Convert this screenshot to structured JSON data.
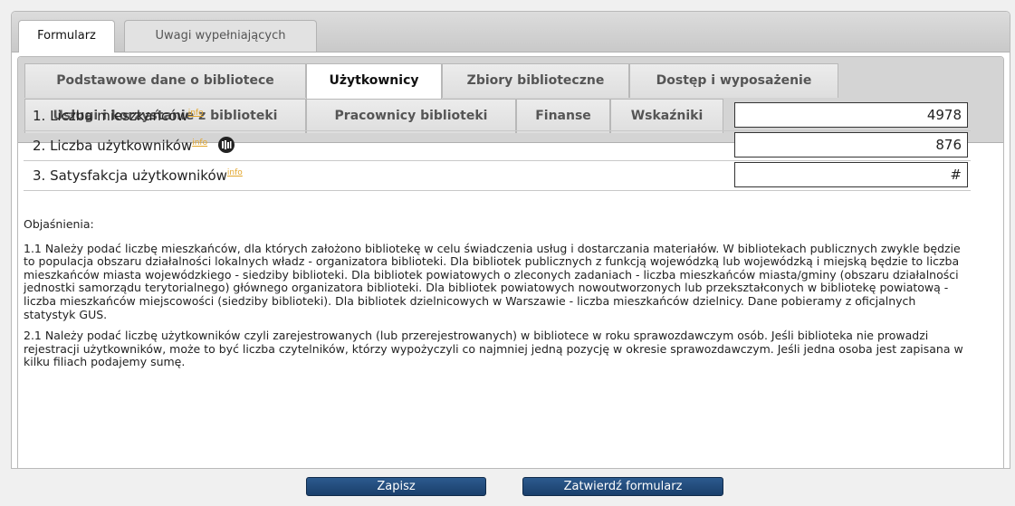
{
  "outer_tabs": [
    {
      "label": "Formularz",
      "active": true
    },
    {
      "label": "Uwagi wypełniających",
      "active": false
    }
  ],
  "inner_tabs_row1": [
    {
      "label": "Podstawowe dane o bibliotece",
      "active": false
    },
    {
      "label": "Użytkownicy",
      "active": true
    },
    {
      "label": "Zbiory biblioteczne",
      "active": false
    },
    {
      "label": "Dostęp i wyposażenie",
      "active": false
    }
  ],
  "inner_tabs_row2": [
    {
      "label": "Usługi i korzystanie z biblioteki",
      "active": false
    },
    {
      "label": "Pracownicy biblioteki",
      "active": false
    },
    {
      "label": "Finanse",
      "active": false
    },
    {
      "label": "Wskaźniki",
      "active": false
    }
  ],
  "info_label": "info",
  "fields": [
    {
      "label": "1. Liczba mieszkańców",
      "value": "4978",
      "gus_icon": false
    },
    {
      "label": "2. Liczba użytkowników",
      "value": "876",
      "gus_icon": true
    },
    {
      "label": "3. Satysfakcja użytkowników",
      "value": "#",
      "gus_icon": false
    }
  ],
  "explanations": {
    "heading": "Objaśnienia:",
    "paragraphs": [
      "1.1 Należy podać liczbę mieszkańców, dla których założono bibliotekę w celu świadczenia usług i dostarczania materiałów. W bibliotekach publicznych zwykle będzie to populacja obszaru działalności lokalnych władz - organizatora biblioteki. Dla bibliotek publicznych z funkcją wojewódzką lub wojewódzką i miejską będzie to liczba mieszkańców miasta wojewódzkiego - siedziby biblioteki. Dla bibliotek powiatowych o zleconych zadaniach - liczba mieszkańców miasta/gminy (obszaru działalności jednostki samorządu terytorialnego) głównego organizatora biblioteki. Dla bibliotek powiatowych nowoutworzonych lub przekształconych w bibliotekę powiatową - liczba mieszkańców miejscowości (siedziby biblioteki). Dla bibliotek dzielnicowych w Warszawie - liczba mieszkańców dzielnicy. Dane pobieramy z oficjalnych statystyk GUS.",
      "2.1 Należy podać liczbę użytkowników czyli zarejestrowanych (lub przerejestrowanych) w bibliotece w roku sprawozdawczym osób. Jeśli biblioteka nie prowadzi rejestracji użytkowników, może to być liczba czytelników, którzy wypożyczyli co najmniej jedną pozycję w okresie sprawozdawczym. Jeśli jedna osoba jest zapisana w kilku filiach podajemy sumę."
    ]
  },
  "buttons": {
    "save": "Zapisz",
    "confirm": "Zatwierdź formularz"
  },
  "colors": {
    "button_bg": "#1e4577",
    "info_link": "#e2a52a",
    "tab_bar": "#d4d4d4"
  }
}
